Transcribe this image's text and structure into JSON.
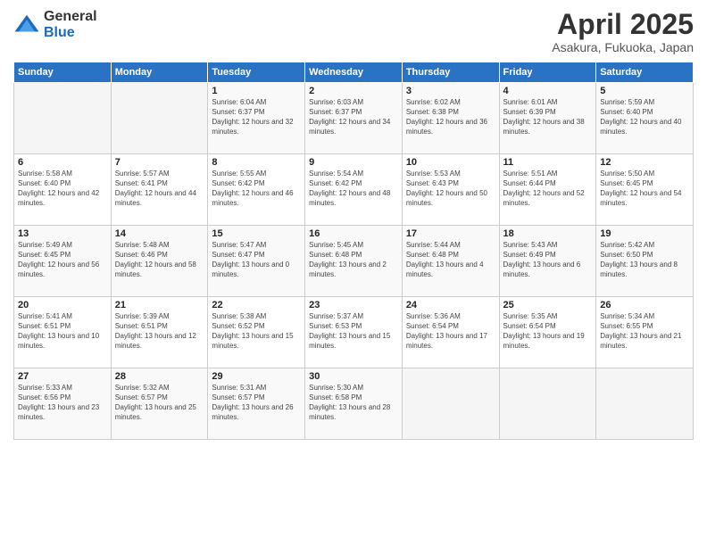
{
  "logo": {
    "general": "General",
    "blue": "Blue"
  },
  "header": {
    "title": "April 2025",
    "subtitle": "Asakura, Fukuoka, Japan"
  },
  "weekdays": [
    "Sunday",
    "Monday",
    "Tuesday",
    "Wednesday",
    "Thursday",
    "Friday",
    "Saturday"
  ],
  "weeks": [
    [
      {
        "day": "",
        "sunrise": "",
        "sunset": "",
        "daylight": ""
      },
      {
        "day": "",
        "sunrise": "",
        "sunset": "",
        "daylight": ""
      },
      {
        "day": "1",
        "sunrise": "Sunrise: 6:04 AM",
        "sunset": "Sunset: 6:37 PM",
        "daylight": "Daylight: 12 hours and 32 minutes."
      },
      {
        "day": "2",
        "sunrise": "Sunrise: 6:03 AM",
        "sunset": "Sunset: 6:37 PM",
        "daylight": "Daylight: 12 hours and 34 minutes."
      },
      {
        "day": "3",
        "sunrise": "Sunrise: 6:02 AM",
        "sunset": "Sunset: 6:38 PM",
        "daylight": "Daylight: 12 hours and 36 minutes."
      },
      {
        "day": "4",
        "sunrise": "Sunrise: 6:01 AM",
        "sunset": "Sunset: 6:39 PM",
        "daylight": "Daylight: 12 hours and 38 minutes."
      },
      {
        "day": "5",
        "sunrise": "Sunrise: 5:59 AM",
        "sunset": "Sunset: 6:40 PM",
        "daylight": "Daylight: 12 hours and 40 minutes."
      }
    ],
    [
      {
        "day": "6",
        "sunrise": "Sunrise: 5:58 AM",
        "sunset": "Sunset: 6:40 PM",
        "daylight": "Daylight: 12 hours and 42 minutes."
      },
      {
        "day": "7",
        "sunrise": "Sunrise: 5:57 AM",
        "sunset": "Sunset: 6:41 PM",
        "daylight": "Daylight: 12 hours and 44 minutes."
      },
      {
        "day": "8",
        "sunrise": "Sunrise: 5:55 AM",
        "sunset": "Sunset: 6:42 PM",
        "daylight": "Daylight: 12 hours and 46 minutes."
      },
      {
        "day": "9",
        "sunrise": "Sunrise: 5:54 AM",
        "sunset": "Sunset: 6:42 PM",
        "daylight": "Daylight: 12 hours and 48 minutes."
      },
      {
        "day": "10",
        "sunrise": "Sunrise: 5:53 AM",
        "sunset": "Sunset: 6:43 PM",
        "daylight": "Daylight: 12 hours and 50 minutes."
      },
      {
        "day": "11",
        "sunrise": "Sunrise: 5:51 AM",
        "sunset": "Sunset: 6:44 PM",
        "daylight": "Daylight: 12 hours and 52 minutes."
      },
      {
        "day": "12",
        "sunrise": "Sunrise: 5:50 AM",
        "sunset": "Sunset: 6:45 PM",
        "daylight": "Daylight: 12 hours and 54 minutes."
      }
    ],
    [
      {
        "day": "13",
        "sunrise": "Sunrise: 5:49 AM",
        "sunset": "Sunset: 6:45 PM",
        "daylight": "Daylight: 12 hours and 56 minutes."
      },
      {
        "day": "14",
        "sunrise": "Sunrise: 5:48 AM",
        "sunset": "Sunset: 6:46 PM",
        "daylight": "Daylight: 12 hours and 58 minutes."
      },
      {
        "day": "15",
        "sunrise": "Sunrise: 5:47 AM",
        "sunset": "Sunset: 6:47 PM",
        "daylight": "Daylight: 13 hours and 0 minutes."
      },
      {
        "day": "16",
        "sunrise": "Sunrise: 5:45 AM",
        "sunset": "Sunset: 6:48 PM",
        "daylight": "Daylight: 13 hours and 2 minutes."
      },
      {
        "day": "17",
        "sunrise": "Sunrise: 5:44 AM",
        "sunset": "Sunset: 6:48 PM",
        "daylight": "Daylight: 13 hours and 4 minutes."
      },
      {
        "day": "18",
        "sunrise": "Sunrise: 5:43 AM",
        "sunset": "Sunset: 6:49 PM",
        "daylight": "Daylight: 13 hours and 6 minutes."
      },
      {
        "day": "19",
        "sunrise": "Sunrise: 5:42 AM",
        "sunset": "Sunset: 6:50 PM",
        "daylight": "Daylight: 13 hours and 8 minutes."
      }
    ],
    [
      {
        "day": "20",
        "sunrise": "Sunrise: 5:41 AM",
        "sunset": "Sunset: 6:51 PM",
        "daylight": "Daylight: 13 hours and 10 minutes."
      },
      {
        "day": "21",
        "sunrise": "Sunrise: 5:39 AM",
        "sunset": "Sunset: 6:51 PM",
        "daylight": "Daylight: 13 hours and 12 minutes."
      },
      {
        "day": "22",
        "sunrise": "Sunrise: 5:38 AM",
        "sunset": "Sunset: 6:52 PM",
        "daylight": "Daylight: 13 hours and 15 minutes."
      },
      {
        "day": "23",
        "sunrise": "Sunrise: 5:37 AM",
        "sunset": "Sunset: 6:53 PM",
        "daylight": "Daylight: 13 hours and 15 minutes."
      },
      {
        "day": "24",
        "sunrise": "Sunrise: 5:36 AM",
        "sunset": "Sunset: 6:54 PM",
        "daylight": "Daylight: 13 hours and 17 minutes."
      },
      {
        "day": "25",
        "sunrise": "Sunrise: 5:35 AM",
        "sunset": "Sunset: 6:54 PM",
        "daylight": "Daylight: 13 hours and 19 minutes."
      },
      {
        "day": "26",
        "sunrise": "Sunrise: 5:34 AM",
        "sunset": "Sunset: 6:55 PM",
        "daylight": "Daylight: 13 hours and 21 minutes."
      }
    ],
    [
      {
        "day": "27",
        "sunrise": "Sunrise: 5:33 AM",
        "sunset": "Sunset: 6:56 PM",
        "daylight": "Daylight: 13 hours and 23 minutes."
      },
      {
        "day": "28",
        "sunrise": "Sunrise: 5:32 AM",
        "sunset": "Sunset: 6:57 PM",
        "daylight": "Daylight: 13 hours and 25 minutes."
      },
      {
        "day": "29",
        "sunrise": "Sunrise: 5:31 AM",
        "sunset": "Sunset: 6:57 PM",
        "daylight": "Daylight: 13 hours and 26 minutes."
      },
      {
        "day": "30",
        "sunrise": "Sunrise: 5:30 AM",
        "sunset": "Sunset: 6:58 PM",
        "daylight": "Daylight: 13 hours and 28 minutes."
      },
      {
        "day": "",
        "sunrise": "",
        "sunset": "",
        "daylight": ""
      },
      {
        "day": "",
        "sunrise": "",
        "sunset": "",
        "daylight": ""
      },
      {
        "day": "",
        "sunrise": "",
        "sunset": "",
        "daylight": ""
      }
    ]
  ]
}
